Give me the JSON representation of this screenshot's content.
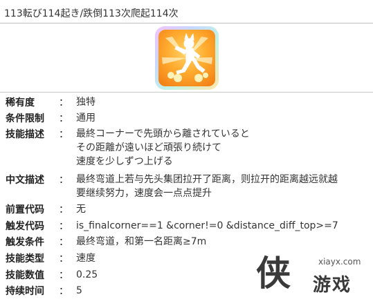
{
  "title": "113転び114起き/跌倒113次爬起114次",
  "icon": {
    "name": "running-figure-skill-icon",
    "colors": {
      "outer": "#ffab2f",
      "inner": "#ffd66b",
      "figure": "#ffffff"
    }
  },
  "fields": [
    {
      "label": "稀有度",
      "colon": "：",
      "value": [
        "独特"
      ]
    },
    {
      "label": "条件限制",
      "colon": "：",
      "value": [
        "通用"
      ]
    },
    {
      "label": "技能描述",
      "colon": "：",
      "value": [
        "最終コーナーで先頭から離されていると",
        "その距離が遠いほど頑張り続けて",
        "速度を少しずつ上げる"
      ]
    },
    {
      "label": "中文描述",
      "colon": "：",
      "value": [
        "最终弯道上若与先头集团拉开了距离，则拉开的距离越远就越",
        "要继续努力，速度会一点点提升"
      ]
    },
    {
      "label": "前置代码",
      "colon": "：",
      "value": [
        "无"
      ]
    },
    {
      "label": "触发代码",
      "colon": "：",
      "value": [
        "is_finalcorner==1 &corner!=0 &distance_diff_top>=7"
      ]
    },
    {
      "label": "触发条件",
      "colon": "：",
      "value": [
        "最终弯道，和第一名距离≥7m"
      ]
    },
    {
      "label": "技能类型",
      "colon": "：",
      "value": [
        "速度"
      ]
    },
    {
      "label": "技能数值",
      "colon": "：",
      "value": [
        "0.25"
      ]
    },
    {
      "label": "持续时间",
      "colon": "：",
      "value": [
        "5"
      ]
    }
  ],
  "watermark": {
    "logo": "侠",
    "url": "xiayx.com",
    "name": "游戏"
  }
}
